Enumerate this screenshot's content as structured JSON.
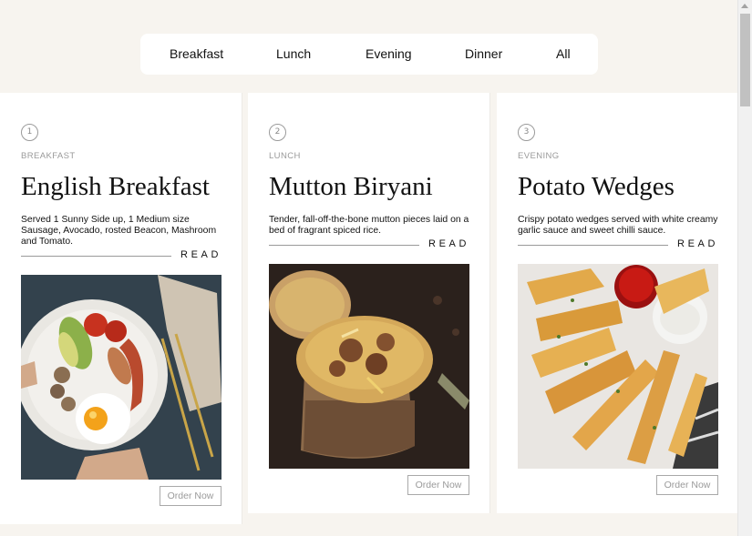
{
  "nav": {
    "items": [
      "Breakfast",
      "Lunch",
      "Evening",
      "Dinner",
      "All"
    ]
  },
  "cards": [
    {
      "number": "1",
      "category": "BREAKFAST",
      "title": "English Breakfast",
      "description": "Served 1 Sunny Side up, 1 Medium size Sausage, Avocado, rosted Beacon, Mashroom and Tomato.",
      "read_label": "READ",
      "order_label": "Order Now"
    },
    {
      "number": "2",
      "category": "LUNCH",
      "title": "Mutton Biryani",
      "description": "Tender, fall-off-the-bone mutton pieces laid on a bed of fragrant spiced rice.",
      "read_label": "READ",
      "order_label": "Order Now"
    },
    {
      "number": "3",
      "category": "EVENING",
      "title": "Potato Wedges",
      "description": "Crispy potato wedges served with white creamy garlic sauce and sweet chilli sauce.",
      "read_label": "READ",
      "order_label": "Order Now"
    }
  ],
  "colors": {
    "page_background": "#f7f4ef",
    "card_background": "#ffffff",
    "muted_text": "#9a9a9a"
  }
}
